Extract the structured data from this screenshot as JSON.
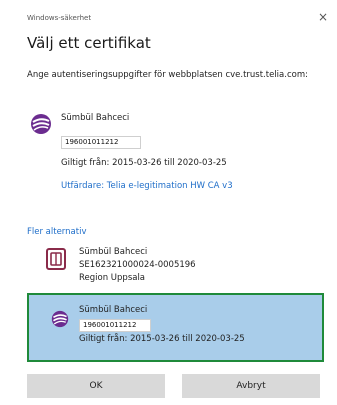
{
  "window": {
    "title": "Windows-säkerhet",
    "close_glyph": "×"
  },
  "dialog": {
    "heading": "Välj ett certifikat",
    "intro": "Ange autentiseringsuppgifter för webbplatsen cve.trust.telia.com:"
  },
  "certificates": [
    {
      "name": "Sümbül Bahceci",
      "serial": "196001011212",
      "valid": "Giltigt från: 2015-03-26 till 2020-03-25",
      "issuer": "Utfärdare: Telia e-legitimation HW CA v3",
      "icon": "telia-logo-icon"
    },
    {
      "name": "Sümbül Bahceci",
      "line2": "SE162321000024-0005196",
      "line3": "Region Uppsala",
      "icon": "smartcard-icon"
    },
    {
      "name": "Sümbül Bahceci",
      "serial": "196001011212",
      "valid": "Giltigt från: 2015-03-26 till 2020-03-25",
      "icon": "telia-logo-icon",
      "selected": true
    }
  ],
  "more_options": "Fler alternativ",
  "buttons": {
    "ok": "OK",
    "cancel": "Avbryt"
  },
  "colors": {
    "link": "#1f6ec9",
    "selection_bg": "#a9cdea",
    "selection_border": "#1f8a3a",
    "telia_purple": "#6b2c8f",
    "button_bg": "#d9d9d9"
  }
}
